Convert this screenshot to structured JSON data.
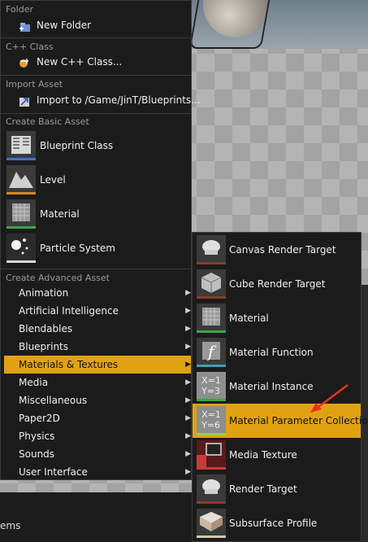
{
  "menu": {
    "sections": {
      "folder": "Folder",
      "cpp": "C++ Class",
      "import": "Import Asset",
      "basic": "Create Basic Asset",
      "advanced": "Create Advanced Asset"
    },
    "new_folder": "New Folder",
    "new_cpp_class": "New C++ Class...",
    "import_to": "Import to /Game/JinT/Blueprints...",
    "basic_assets": [
      "Blueprint Class",
      "Level",
      "Material",
      "Particle System"
    ],
    "advanced_assets": [
      "Animation",
      "Artificial Intelligence",
      "Blendables",
      "Blueprints",
      "Materials & Textures",
      "Media",
      "Miscellaneous",
      "Paper2D",
      "Physics",
      "Sounds",
      "User Interface"
    ],
    "active_advanced": "Materials & Textures"
  },
  "submenu": {
    "items": [
      "Canvas Render Target",
      "Cube Render Target",
      "Material",
      "Material Function",
      "Material Instance",
      "Material Parameter Collection",
      "Media Texture",
      "Render Target",
      "Subsurface Profile"
    ],
    "glyphs": {
      "material_instance": "X=1\nY=3",
      "material_parameter_collection": "X=1\nY=6",
      "material_function": "f"
    },
    "active": "Material Parameter Collection"
  },
  "background": {
    "bottom_label": "ems"
  },
  "colors": {
    "highlight": "#e1a212",
    "menu_bg": "#1b1b1b",
    "blueprint_bar": "#3b6fd4",
    "level_bar": "#d28a1e",
    "material_bar": "#38a844",
    "particle_bar": "#d8d8d8",
    "render_target_bar": "#8a3a2a",
    "arrow": "#e8321c"
  }
}
